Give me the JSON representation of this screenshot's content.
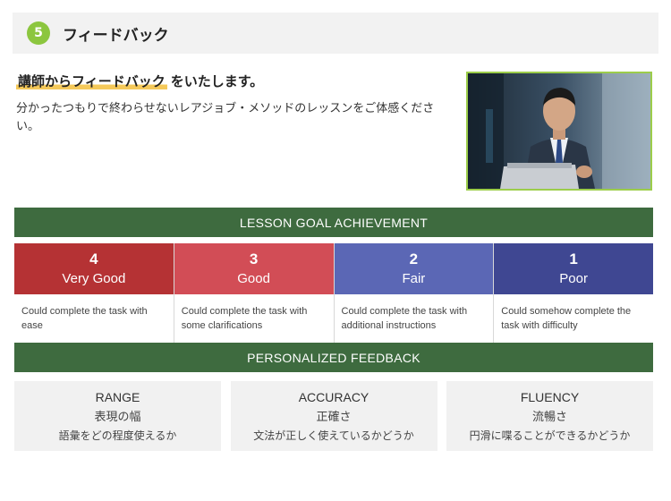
{
  "header": {
    "step_number": "5",
    "title": "フィードバック"
  },
  "intro": {
    "headline_highlight": "講師からフィードバック",
    "headline_rest": "をいたします。",
    "description": "分かったつもりで終わらせないレアジョブ・メソッドのレッスンをご体感ください。"
  },
  "goal_section": {
    "title": "LESSON GOAL ACHIEVEMENT",
    "levels": [
      {
        "score": "4",
        "label": "Very Good",
        "description": "Could complete the task with ease",
        "color": "#b53234"
      },
      {
        "score": "3",
        "label": "Good",
        "description": "Could complete the task with some clarifications",
        "color": "#d24d56"
      },
      {
        "score": "2",
        "label": "Fair",
        "description": "Could complete the task with additional instructions",
        "color": "#5b67b5"
      },
      {
        "score": "1",
        "label": "Poor",
        "description": "Could somehow complete the task with difficulty",
        "color": "#3f4792"
      }
    ]
  },
  "feedback_section": {
    "title": "PERSONALIZED FEEDBACK",
    "skills": [
      {
        "name_en": "RANGE",
        "name_jp": "表現の幅",
        "question": "語彙をどの程度使えるか"
      },
      {
        "name_en": "ACCURACY",
        "name_jp": "正確さ",
        "question": "文法が正しく使えているかどうか"
      },
      {
        "name_en": "FLUENCY",
        "name_jp": "流暢さ",
        "question": "円滑に喋ることができるかどうか"
      }
    ]
  },
  "colors": {
    "accent_green": "#8cc63f",
    "band_green": "#3e6b3f",
    "highlight_yellow": "#f5c95a"
  },
  "photo": {
    "icon": "person-with-laptop-photo"
  }
}
